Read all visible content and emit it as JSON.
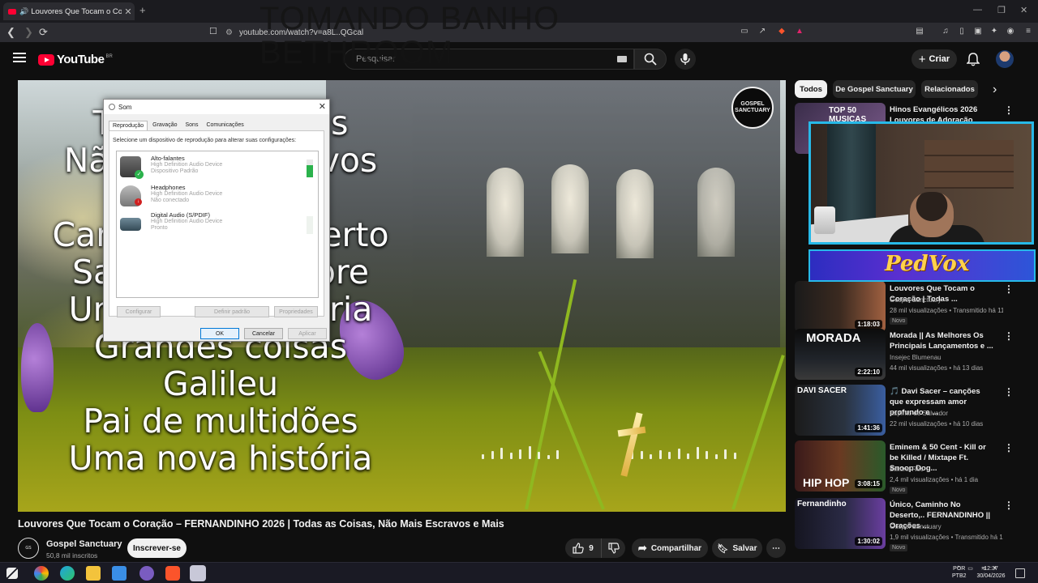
{
  "browser": {
    "tab_title": "Louvores Que Tocam o Coraç",
    "url": "youtube.com/watch?v=a8L..QGcal"
  },
  "overlay_text": "TOMANDO BANHO\nBETHROOM",
  "youtube_header": {
    "logo_text": "YouTube",
    "logo_region": "BR",
    "search_placeholder": "Pesquisar",
    "create_label": "Criar"
  },
  "video": {
    "title": "Louvores Que Tocam o Coração – FERNANDINHO 2026 | Todas as Coisas, Não Mais Escravos e Mais",
    "lyrics": [
      "Todas as coisas",
      "Não mais escravos",
      "",
      "Caminho no deserto",
      "Santo pra sempre",
      "Uma nova história",
      "Grandes coisas",
      "Galileu",
      "Pai de multidões",
      "Uma nova história"
    ],
    "badge_text": "GOSPEL SANCTUARY",
    "channel_name": "Gospel Sanctuary",
    "channel_subs": "50,8 mil inscritos",
    "subscribe_label": "Inscrever-se",
    "likes": "9",
    "share_label": "Compartilhar",
    "save_label": "Salvar"
  },
  "sound_dialog": {
    "title": "Som",
    "tabs": [
      "Reprodução",
      "Gravação",
      "Sons",
      "Comunicações"
    ],
    "instruction": "Selecione um dispositivo de reprodução para alterar suas configurações:",
    "devices": [
      {
        "name": "Alto-falantes",
        "driver": "High Definition Audio Device",
        "status": "Dispositivo Padrão",
        "level": 0.7
      },
      {
        "name": "Headphones",
        "driver": "High Definition Audio Device",
        "status": "Não conectado",
        "level": 0
      },
      {
        "name": "Digital Audio (S/PDIF)",
        "driver": "High Definition Audio Device",
        "status": "Pronto",
        "level": 0
      }
    ],
    "configure_label": "Configurar",
    "set_default_label": "Definir padrão",
    "properties_label": "Propriedades",
    "ok_label": "OK",
    "cancel_label": "Cancelar",
    "apply_label": "Aplicar"
  },
  "sidebar": {
    "chips": [
      "Todos",
      "De Gospel Sanctuary",
      "Relacionados"
    ],
    "recommendations": [
      {
        "title": "Hinos Evangélicos 2026 Louvores de Adoração",
        "channel": "",
        "meta": "",
        "duration": "",
        "new": "",
        "thumb_text": "TOP 50 MUSICAS"
      },
      {
        "title": "Louvores Que Tocam o Coração | Todas ...",
        "channel": "Gospel Sanctuary",
        "meta": "28 mil visualizações • Transmitido há 11...",
        "duration": "1:18:03",
        "new": "Novo",
        "thumb_text": ""
      },
      {
        "title": "Morada || As Melhores Os Principais Lançamentos e ...",
        "channel": "Insejec Blumenau",
        "meta": "44 mil visualizações • há 13 dias",
        "duration": "2:22:10",
        "new": "",
        "thumb_text": "MORADA"
      },
      {
        "title": "🎵 Davi Sacer – canções que expressam amor profundo e ...",
        "channel": "Espírito do Salvador",
        "meta": "22 mil visualizações • há 10 dias",
        "duration": "1:41:36",
        "new": "",
        "thumb_text": "DAVI SACER"
      },
      {
        "title": "Eminem & 50 Cent - Kill or be Killed / Mixtape Ft. Snoop Dog...",
        "channel": "Billions Rec",
        "meta": "2,4 mil visualizações • há 1 dia",
        "duration": "3:08:15",
        "new": "Novo",
        "thumb_text": "HIP HOP"
      },
      {
        "title": "Único, Caminho No Deserto,.. FERNANDINHO || Orações ...",
        "channel": "Gospel Sanctuary",
        "meta": "1,9 mil visualizações • Transmitido há 1...",
        "duration": "1:30:02",
        "new": "Novo",
        "thumb_text": "Fernandinho"
      }
    ]
  },
  "stream_banner": "PedVox",
  "taskbar": {
    "lang": "POR",
    "lang2": "PTB2",
    "time": "12:37",
    "date": "30/04/2026"
  }
}
